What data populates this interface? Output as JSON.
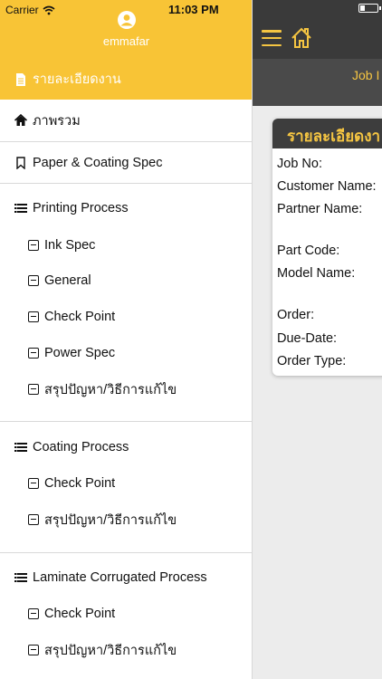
{
  "status_bar": {
    "carrier": "Carrier",
    "time": "11:03 PM"
  },
  "user": {
    "name": "emmafar"
  },
  "drawer": {
    "active": "รายละเอียดงาน",
    "overview": "ภาพรวม",
    "paper_coating": "Paper & Coating Spec",
    "printing": {
      "title": "Printing Process",
      "items": [
        "Ink Spec",
        "General",
        "Check Point",
        "Power Spec",
        "สรุปปัญหา/วิธีการแก้ไข"
      ]
    },
    "coating": {
      "title": "Coating Process",
      "items": [
        "Check Point",
        "สรุปปัญหา/วิธีการแก้ไข"
      ]
    },
    "laminate": {
      "title": "Laminate Corrugated Process",
      "items": [
        "Check Point",
        "สรุปปัญหา/วิธีการแก้ไข"
      ]
    }
  },
  "background": {
    "sub_title": "Job I",
    "card_title": "รายละเอียดงา",
    "fields": [
      "Job No:",
      "Customer Name:",
      "Partner Name:",
      "Part Code:",
      "Model Name:",
      "Order:",
      "Due-Date:",
      "Order Type:"
    ]
  },
  "colors": {
    "accent": "#f8c436",
    "dark": "#3a3a3a"
  },
  "icons": {
    "active": "document-icon",
    "overview": "home-icon",
    "paper_coating": "bookmark-icon",
    "process": "list-icon",
    "sub": "minus-square-icon"
  }
}
